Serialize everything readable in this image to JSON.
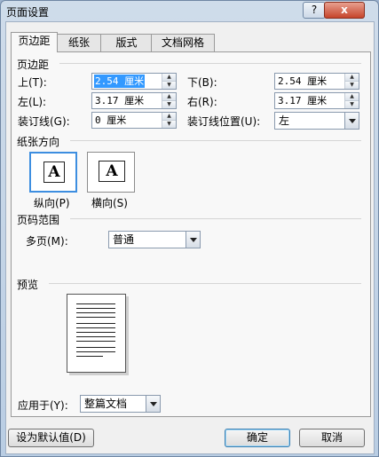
{
  "window": {
    "title": "页面设置",
    "help": "?",
    "close": "x"
  },
  "tabs": [
    "页边距",
    "纸张",
    "版式",
    "文档网格"
  ],
  "margins": {
    "section": "页边距",
    "top": {
      "label": "上(T):",
      "value": "2.54 厘米"
    },
    "bottom": {
      "label": "下(B):",
      "value": "2.54 厘米"
    },
    "left": {
      "label": "左(L):",
      "value": "3.17 厘米"
    },
    "right": {
      "label": "右(R):",
      "value": "3.17 厘米"
    },
    "gutter": {
      "label": "装订线(G):",
      "value": "0 厘米"
    },
    "gutter_pos": {
      "label": "装订线位置(U):",
      "value": "左"
    }
  },
  "orientation": {
    "section": "纸张方向",
    "glyph": "A",
    "portrait": "纵向(P)",
    "landscape": "横向(S)"
  },
  "pages": {
    "section": "页码范围",
    "label": "多页(M):",
    "value": "普通"
  },
  "preview": {
    "section": "预览"
  },
  "apply": {
    "label": "应用于(Y):",
    "value": "整篇文档"
  },
  "buttons": {
    "set_default": "设为默认值(D)",
    "ok": "确定",
    "cancel": "取消"
  }
}
